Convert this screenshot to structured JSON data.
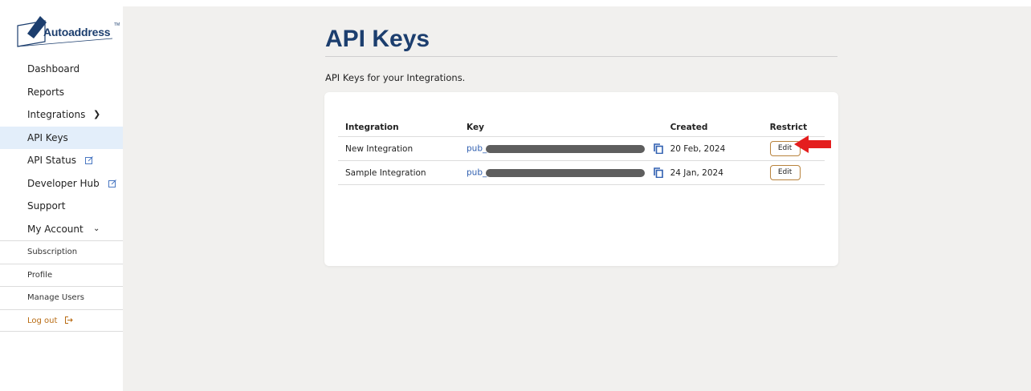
{
  "brand": {
    "name": "Autoaddress",
    "tm": "TM"
  },
  "sidebar": {
    "items": [
      {
        "label": "Dashboard"
      },
      {
        "label": "Reports"
      },
      {
        "label": "Integrations",
        "chevron": ">"
      },
      {
        "label": "API Keys",
        "active": true
      },
      {
        "label": "API Status",
        "icon": "external-link-icon"
      },
      {
        "label": "Developer Hub",
        "icon": "external-link-icon"
      },
      {
        "label": "Support"
      },
      {
        "label": "My Account",
        "chevron": "v"
      }
    ],
    "account_items": [
      {
        "label": "Subscription"
      },
      {
        "label": "Profile"
      },
      {
        "label": "Manage Users"
      },
      {
        "label": "Log out",
        "icon": "logout-icon"
      }
    ]
  },
  "page": {
    "title": "API Keys",
    "subtitle": "API Keys for your Integrations."
  },
  "table": {
    "headers": [
      "Integration",
      "Key",
      "Created",
      "Restrict"
    ],
    "rows": [
      {
        "integration": "New Integration",
        "key_prefix": "pub_",
        "created": "20 Feb, 2024",
        "action": "Edit"
      },
      {
        "integration": "Sample Integration",
        "key_prefix": "pub_",
        "created": "24 Jan, 2024",
        "action": "Edit"
      }
    ]
  },
  "colors": {
    "brand_navy": "#1c3e6e",
    "active_nav_bg": "#e3eefa",
    "edit_border": "#b8823c",
    "logout_color": "#b86b12",
    "annotation_arrow": "#e41e1e"
  }
}
